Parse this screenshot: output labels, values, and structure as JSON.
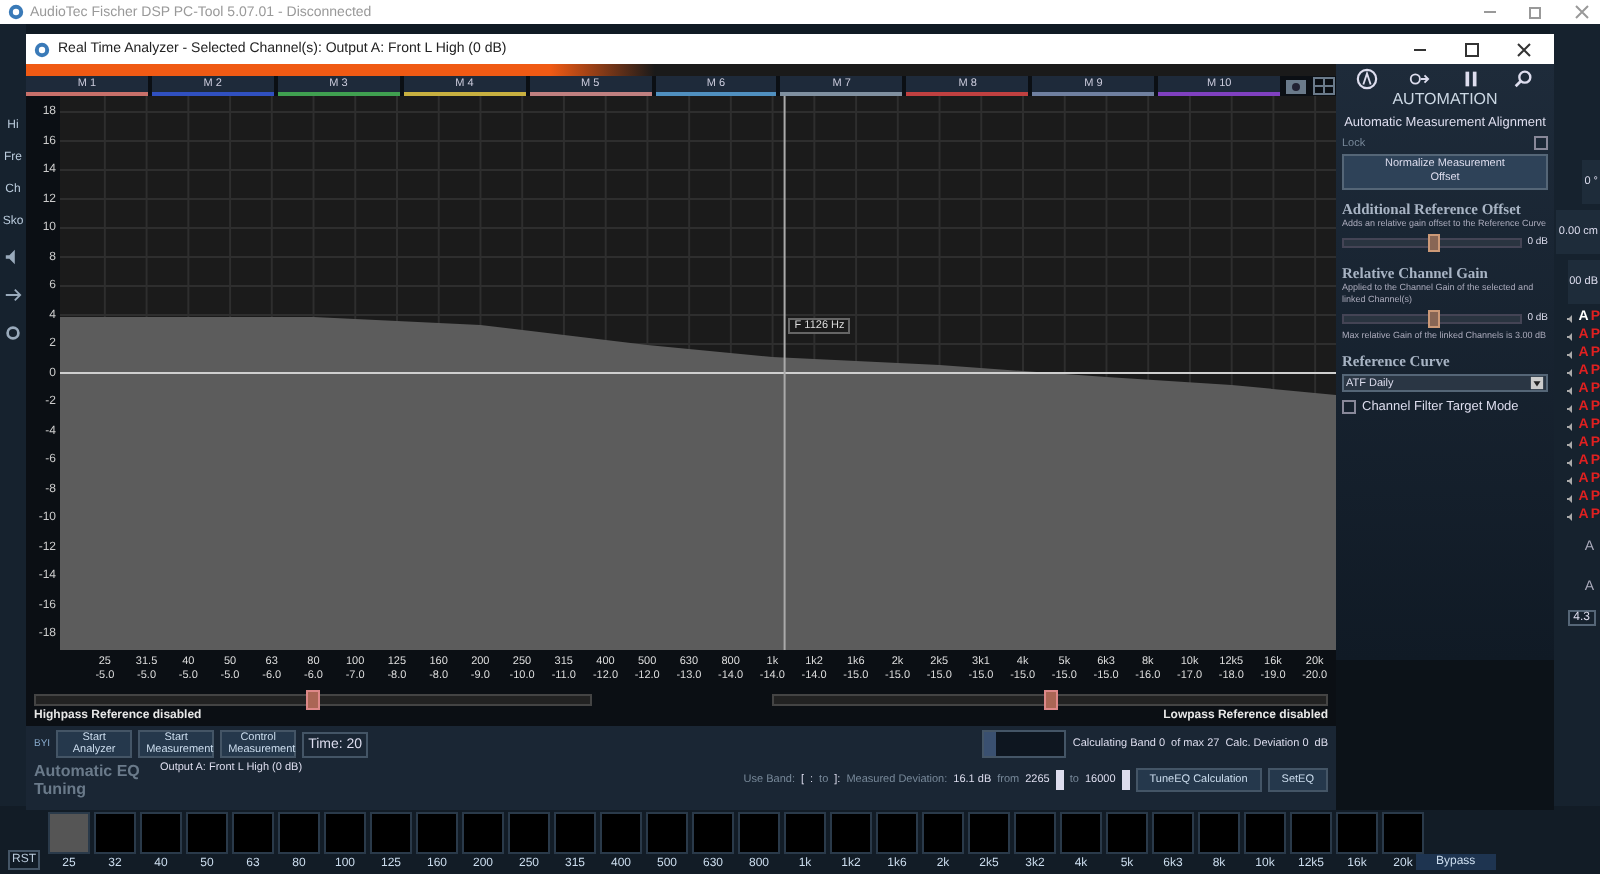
{
  "app": {
    "title": "AudioTec Fischer DSP PC-Tool 5.07.01 - Disconnected"
  },
  "left_strip": [
    "Hi",
    "Fre",
    "Ch",
    "Sko"
  ],
  "right_strip": {
    "angle": "0 °",
    "distance": "0.00 cm",
    "gain": "00 dB",
    "channels": [
      {
        "a": "A",
        "p": "P",
        "selected": true
      },
      {
        "a": "A",
        "p": "P",
        "selected": false
      },
      {
        "a": "A",
        "p": "P",
        "selected": false
      },
      {
        "a": "A",
        "p": "P",
        "selected": false
      },
      {
        "a": "A",
        "p": "P",
        "selected": false
      },
      {
        "a": "A",
        "p": "P",
        "selected": false
      },
      {
        "a": "A",
        "p": "P",
        "selected": false
      },
      {
        "a": "A",
        "p": "P",
        "selected": false
      },
      {
        "a": "A",
        "p": "P",
        "selected": false
      },
      {
        "a": "A",
        "p": "P",
        "selected": false
      },
      {
        "a": "A",
        "p": "P",
        "selected": false
      },
      {
        "a": "A",
        "p": "P",
        "selected": false
      }
    ],
    "extra": [
      "A",
      "A"
    ],
    "value": "4.3"
  },
  "rta": {
    "title": "Real Time Analyzer - Selected Channel(s): Output A: Front L High (0 dB)",
    "memories": [
      {
        "label": "M 1",
        "color": "#c8706a"
      },
      {
        "label": "M 2",
        "color": "#3050c0"
      },
      {
        "label": "M 3",
        "color": "#40a050"
      },
      {
        "label": "M 4",
        "color": "#c8b040"
      },
      {
        "label": "M 5",
        "color": "#c08080"
      },
      {
        "label": "M 6",
        "color": "#5090c0"
      },
      {
        "label": "M 7",
        "color": "#8090a0"
      },
      {
        "label": "M 8",
        "color": "#c04040"
      },
      {
        "label": "M 9",
        "color": "#7080a0"
      },
      {
        "label": "M 10",
        "color": "#8040c0"
      }
    ],
    "y_labels": [
      "18",
      "16",
      "14",
      "12",
      "10",
      "8",
      "6",
      "4",
      "2",
      "0",
      "-2",
      "-4",
      "-6",
      "-8",
      "-10",
      "-12",
      "-14",
      "-16",
      "-18"
    ],
    "cursor_label": "F 1126 Hz",
    "bands": [
      {
        "freq": "25",
        "ref": "-5.0"
      },
      {
        "freq": "31.5",
        "ref": "-5.0"
      },
      {
        "freq": "40",
        "ref": "-5.0"
      },
      {
        "freq": "50",
        "ref": "-5.0"
      },
      {
        "freq": "63",
        "ref": "-6.0"
      },
      {
        "freq": "80",
        "ref": "-6.0"
      },
      {
        "freq": "100",
        "ref": "-7.0"
      },
      {
        "freq": "125",
        "ref": "-8.0"
      },
      {
        "freq": "160",
        "ref": "-8.0"
      },
      {
        "freq": "200",
        "ref": "-9.0"
      },
      {
        "freq": "250",
        "ref": "-10.0"
      },
      {
        "freq": "315",
        "ref": "-11.0"
      },
      {
        "freq": "400",
        "ref": "-12.0"
      },
      {
        "freq": "500",
        "ref": "-12.0"
      },
      {
        "freq": "630",
        "ref": "-13.0"
      },
      {
        "freq": "800",
        "ref": "-14.0"
      },
      {
        "freq": "1k",
        "ref": "-14.0"
      },
      {
        "freq": "1k2",
        "ref": "-14.0"
      },
      {
        "freq": "1k6",
        "ref": "-15.0"
      },
      {
        "freq": "2k",
        "ref": "-15.0"
      },
      {
        "freq": "2k5",
        "ref": "-15.0"
      },
      {
        "freq": "3k1",
        "ref": "-15.0"
      },
      {
        "freq": "4k",
        "ref": "-15.0"
      },
      {
        "freq": "5k",
        "ref": "-15.0"
      },
      {
        "freq": "6k3",
        "ref": "-15.0"
      },
      {
        "freq": "8k",
        "ref": "-16.0"
      },
      {
        "freq": "10k",
        "ref": "-17.0"
      },
      {
        "freq": "12k5",
        "ref": "-18.0"
      },
      {
        "freq": "16k",
        "ref": "-19.0"
      },
      {
        "freq": "20k",
        "ref": "-20.0"
      }
    ],
    "highpass": {
      "level": 0.5,
      "label": "Highpass Reference disabled"
    },
    "lowpass": {
      "level": 0.5,
      "label": "Lowpass Reference disabled"
    },
    "controls": {
      "prefix": "BYI",
      "buttons": [
        "Start Analyzer",
        "Start Measurement",
        "Control Measurement"
      ],
      "time": "Time: 20",
      "progress": {
        "level": 0.15
      },
      "calc": [
        "Calculating Band 0",
        "of max 27",
        "Calc. Deviation 0",
        "dB"
      ]
    },
    "eq_tuning": {
      "title": "Automatic EQ Tuning",
      "output": "Output A: Front L High (0 dB)",
      "use_band": "Use Band:",
      "band_open": "[",
      "band_sep": ":",
      "band_to": "to",
      "band_close": "]:",
      "deviation_label": "Measured Deviation:",
      "deviation": "16.1 dB",
      "from_label": "from",
      "from": "2265",
      "to_label": "to",
      "to": "16000",
      "buttons": [
        "TuneEQ Calculation",
        "SetEQ"
      ]
    },
    "automation": {
      "heading": "AUTOMATION",
      "title": "Automatic Measurement Alignment",
      "lock": {
        "label": "Lock",
        "checked": false
      },
      "normalize_button": "Normalize Measurement Offset",
      "offset": {
        "title": "Additional Reference Offset",
        "description": "Adds an relative gain offset to the Reference Curve",
        "level": 0.5,
        "reading": "0 dB"
      },
      "gain": {
        "title": "Relative Channel Gain",
        "description": "Applied to the Channel Gain of the selected and linked Channel(s)",
        "level": 0.5,
        "reading": "0 dB",
        "note": "Max relative Gain of the linked Channels is 3.00 dB"
      },
      "curve": {
        "title": "Reference Curve",
        "value": "ATF Daily"
      },
      "target_mode": {
        "label": "Channel Filter Target Mode",
        "checked": false
      }
    }
  },
  "eq_bands": {
    "reset": "RST",
    "labels": [
      "25",
      "32",
      "40",
      "50",
      "63",
      "80",
      "100",
      "125",
      "160",
      "200",
      "250",
      "315",
      "400",
      "500",
      "630",
      "800",
      "1k",
      "1k2",
      "1k6",
      "2k",
      "2k5",
      "3k2",
      "4k",
      "5k",
      "6k3",
      "8k",
      "10k",
      "12k5",
      "16k",
      "20k"
    ],
    "bypass": "Bypass"
  }
}
